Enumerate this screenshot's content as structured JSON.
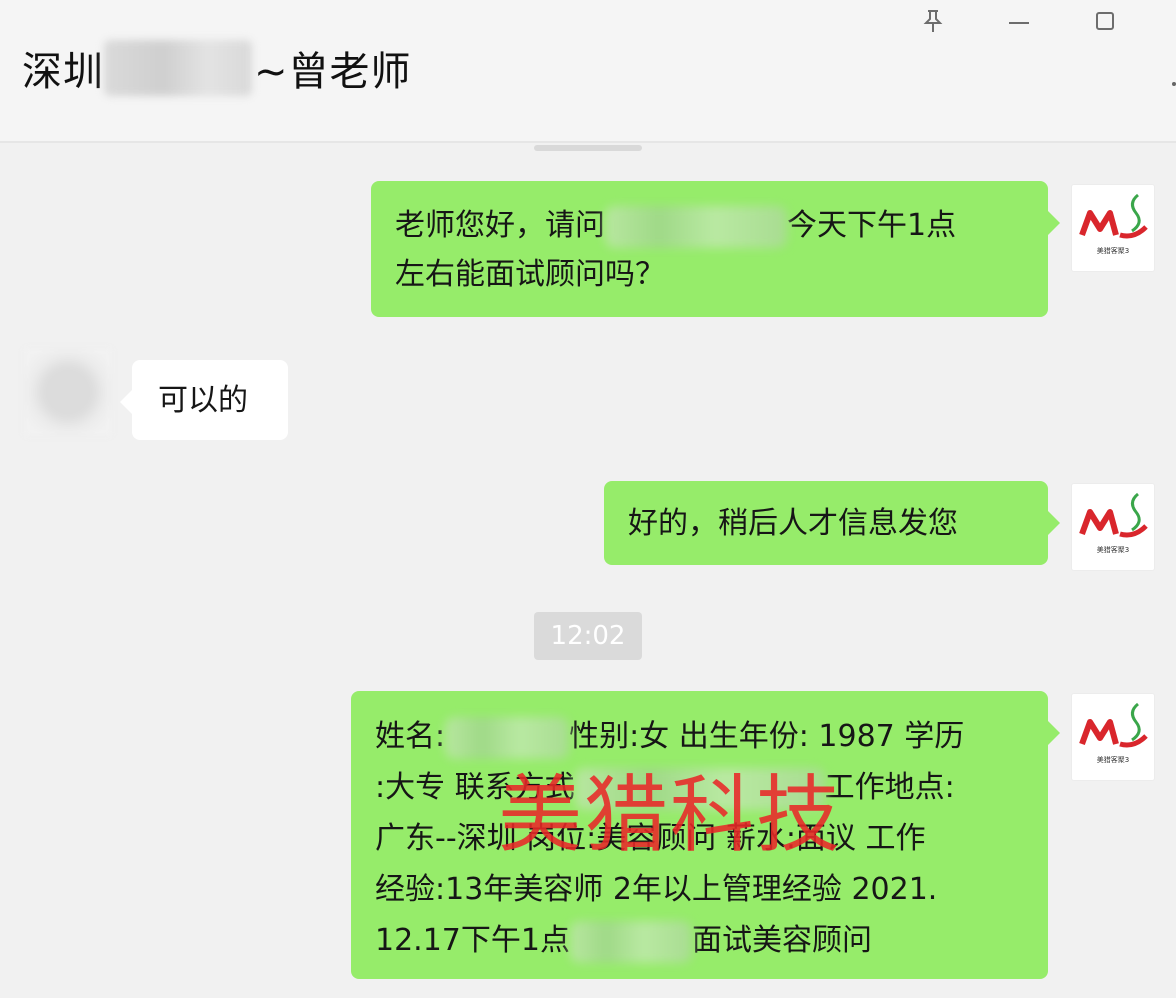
{
  "header": {
    "title_prefix": "深圳",
    "title_suffix": "~曾老师",
    "pin_icon": "pin-icon",
    "minimize_icon": "minimize-icon",
    "maximize_icon": "maximize-icon",
    "more_icon": "more-icon"
  },
  "messages": [
    {
      "sender": "self",
      "line1_start": "老师您好，请问",
      "line1_end": "今天下午1点",
      "line2": "左右能面试顾问吗？"
    },
    {
      "sender": "other",
      "text": "可以的"
    },
    {
      "sender": "self",
      "text": "好的，稍后人才信息发您"
    },
    {
      "sender": "self",
      "line1_start": "姓名:",
      "line1_end": "性别:女 出生年份: 1987 学历",
      "line2": ":大专 联系方式",
      "line2_end": "工作地点:",
      "line3": "广东--深圳 岗位:美容顾问 薪水:面议 工作",
      "line4": "经验:13年美容师 2年以上管理经验 2021.",
      "line5_start": "12.17下午1点",
      "line5_end": "面试美容顾问"
    }
  ],
  "timestamp": "12:02",
  "watermark": "美猎科技",
  "avatar": {
    "logo_text": "ML",
    "caption": "美猎客聚3"
  },
  "colors": {
    "self_bubble": "#96ec6a",
    "other_bubble": "#ffffff",
    "background": "#f1f1f1",
    "watermark": "#e82828",
    "logo_red": "#d9262c",
    "logo_green": "#3aa64a"
  }
}
